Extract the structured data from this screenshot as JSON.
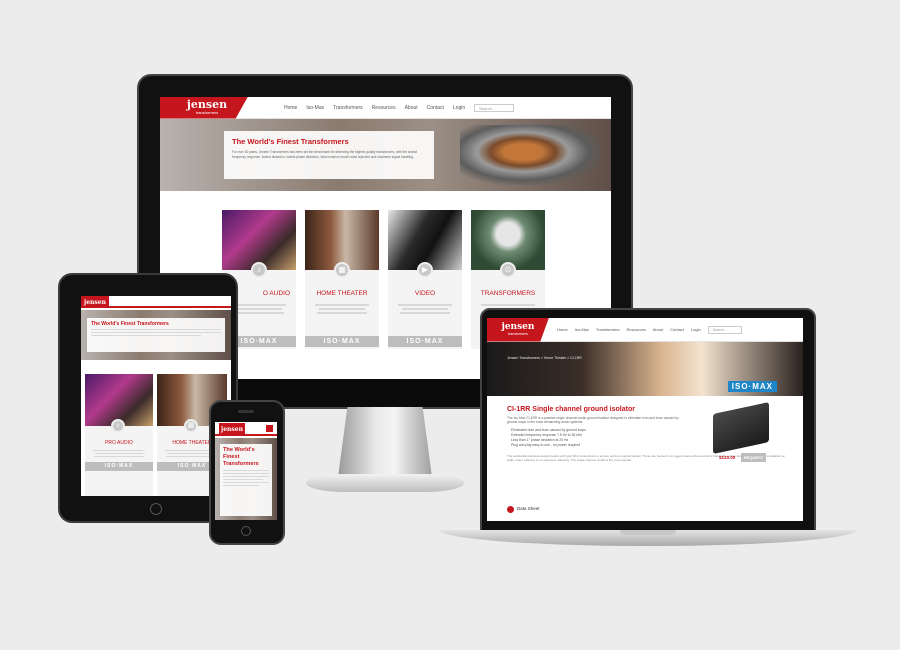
{
  "brand": {
    "logo_text": "jensen",
    "logo_sub": "transformers"
  },
  "nav": {
    "items": [
      "Home",
      "Iso-Max",
      "Transformers",
      "Resources",
      "About",
      "Contact",
      "Login"
    ],
    "search_placeholder": "Search..."
  },
  "hero": {
    "title": "The World's Finest Transformers",
    "text": "For over 30 years, Jensen Transformers has been set the benchmark for delivering the highest quality transformers, with the widest frequency response, lowest distortion, lowest phase distortion, best common mode noise rejection and maximum signal handling."
  },
  "tiles": [
    {
      "title": "PRO AUDIO",
      "badge": "ISO·MAX"
    },
    {
      "title": "HOME THEATER",
      "badge": "ISO·MAX"
    },
    {
      "title": "VIDEO",
      "badge": "ISO·MAX"
    },
    {
      "title": "TRANSFORMERS",
      "badge": ""
    }
  ],
  "monitor_tile_1_title": "O AUDIO",
  "phone": {
    "hero_title": "The World's Finest Transformers"
  },
  "product": {
    "breadcrumb": "Jensen Transformers > Home Theater > CI-1RR",
    "banner_logo": "ISO·MAX",
    "title": "CI-1RR Single channel ground isolator",
    "intro": "The Iso-Max CI-1RR is a passive single channel audio ground isolator designed to eliminate hum and buzz caused by ground loops in the most demanding audio systems.",
    "bullets": [
      "Eliminates hum and buzz caused by ground loops",
      "Extended frequency response 7.5 Hz to 38 kHz",
      "Less than 1° phase deviation at 20 Hz",
      "Plug and play easy to use - no power required"
    ],
    "description": "The substantial stainless design begins with gold RCA connections to ensure optimum signal transfer. These are housed in a rugged steel enclosure that is fitted with anchor down flanges for easy installation on walls, under cabinets or on electronic cabinetry. The single channel model is the most popular.",
    "price": "$120.00",
    "request_label": "REQUEST",
    "datasheet_label": "Data Sheet"
  },
  "colors": {
    "brand_red": "#c4161c",
    "badge_grey": "#bdbdbd"
  }
}
